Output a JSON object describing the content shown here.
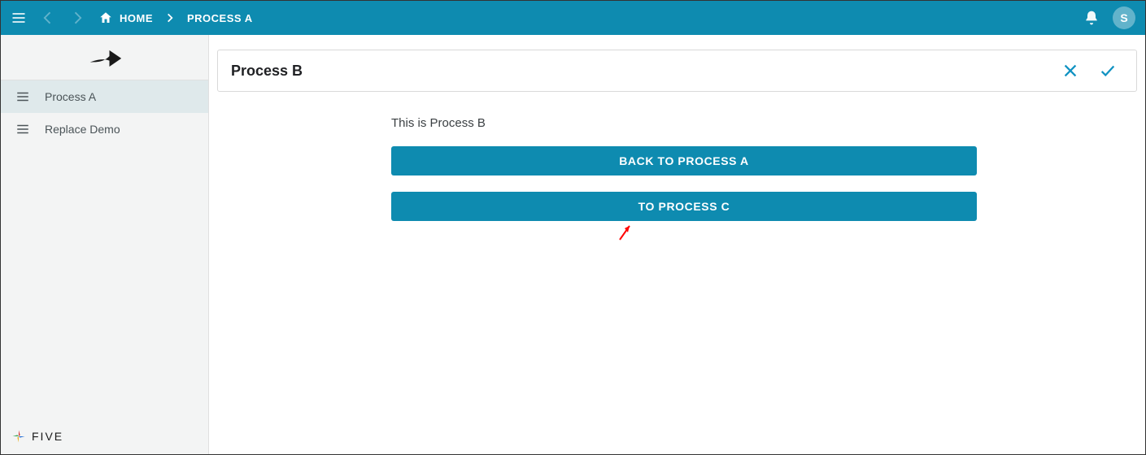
{
  "header": {
    "home_label": "HOME",
    "breadcrumb_current": "PROCESS A",
    "avatar_initial": "S"
  },
  "sidebar": {
    "items": [
      {
        "label": "Process A",
        "active": true
      },
      {
        "label": "Replace Demo",
        "active": false
      }
    ],
    "footer_brand": "FIVE"
  },
  "panel": {
    "title": "Process B",
    "description": "This is Process B",
    "button_back_label": "BACK TO PROCESS A",
    "button_next_label": "TO PROCESS C"
  },
  "colors": {
    "topbar": "#0e8bb0",
    "button": "#0e8bb0",
    "annotation": "#ff0000"
  }
}
